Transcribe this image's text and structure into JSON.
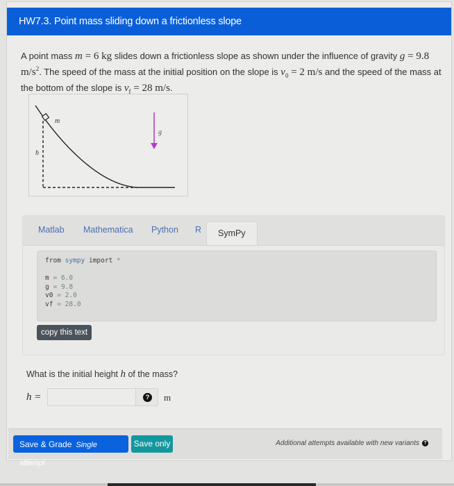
{
  "header": {
    "title": "HW7.3. Point mass sliding down a frictionless slope"
  },
  "problem": {
    "line1_a": "A point mass ",
    "m_sym": "m",
    "m_eq": " = 6 kg",
    "line1_b": " slides down a frictionless slope as shown under the influence of gravity ",
    "g_sym": "g",
    "g_eq": " = 9.8 m/s",
    "g_exp": "2",
    "line1_end": ".",
    "line2_a": "The speed of the mass at the initial position on the slope is ",
    "v0_sym": "v",
    "v0_sub": "0",
    "v0_eq": " = 2 m/s",
    "line2_b": " and the speed of the mass at the bottom of the slope is ",
    "vf_sym": "v",
    "vf_sub": "f",
    "vf_eq": " = 28 m/s",
    "line2_end": "."
  },
  "figure": {
    "mass_label": "m",
    "height_label": "h",
    "gravity_label": "g",
    "gravity_color": "#b93ccf"
  },
  "code_tabs": {
    "tabs": [
      {
        "label": "Matlab",
        "active": false
      },
      {
        "label": "Mathematica",
        "active": false
      },
      {
        "label": "Python",
        "active": false
      },
      {
        "label": "R",
        "active": false
      },
      {
        "label": "SymPy",
        "active": true
      }
    ],
    "code": {
      "import_kw1": "from",
      "import_mod": "sympy",
      "import_kw2": "import",
      "import_star": "*",
      "vars": [
        {
          "name": "m",
          "value": "6.0"
        },
        {
          "name": "g",
          "value": "9.8"
        },
        {
          "name": "v0",
          "value": "2.0"
        },
        {
          "name": "vf",
          "value": "28.0"
        }
      ]
    },
    "copy_label": "copy this text"
  },
  "question": {
    "text_a": "What is the initial height ",
    "h_sym": "h",
    "text_b": " of the mass?",
    "answer_label": "h =",
    "answer_value": "",
    "help_icon": "?",
    "unit": "m"
  },
  "footer": {
    "grade_label": "Save & Grade",
    "grade_sub": "Single attempt",
    "save_label": "Save only",
    "attempts_text": "Additional attempts available with new variants",
    "attempts_icon": "?"
  },
  "colors": {
    "header_bg": "#0a5fd9",
    "grade_btn": "#0a62de",
    "save_btn": "#13979e",
    "copy_btn": "#4a525a"
  }
}
